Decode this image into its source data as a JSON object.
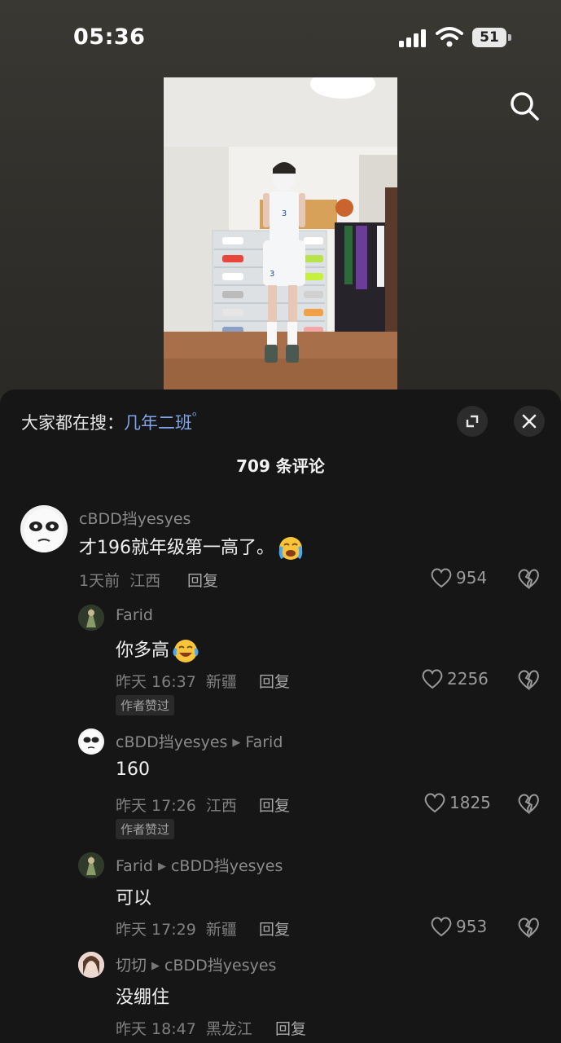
{
  "status": {
    "time": "05:36",
    "battery": "51"
  },
  "header": {
    "hot_search_prefix": "大家都在搜：",
    "hot_search_term": "几年二班"
  },
  "comment_count": "709 条评论",
  "comments": [
    {
      "user": "cBDD挡yesyes",
      "reply_to": "",
      "text": "才196就年级第一高了。",
      "time": "1天前",
      "location": "江西",
      "reply": "回复",
      "likes": "954",
      "badge": ""
    },
    {
      "user": "Farid",
      "reply_to": "",
      "text": "你多高",
      "time": "昨天 16:37",
      "location": "新疆",
      "reply": "回复",
      "likes": "2256",
      "badge": "作者赞过"
    },
    {
      "user": "cBDD挡yesyes",
      "reply_to": "Farid",
      "text": "160",
      "time": "昨天 17:26",
      "location": "江西",
      "reply": "回复",
      "likes": "1825",
      "badge": "作者赞过"
    },
    {
      "user": "Farid",
      "reply_to": "cBDD挡yesyes",
      "text": "可以",
      "time": "昨天 17:29",
      "location": "新疆",
      "reply": "回复",
      "likes": "953",
      "badge": ""
    },
    {
      "user": "切切",
      "reply_to": "cBDD挡yesyes",
      "text": "没绷住",
      "time": "昨天 18:47",
      "location": "黑龙江",
      "reply": "回复",
      "likes": "",
      "badge": ""
    }
  ],
  "icons": {
    "search": "search-icon",
    "expand": "expand-icon",
    "close": "close-icon",
    "like": "heart-icon",
    "dislike": "broken-heart-icon"
  },
  "colors": {
    "panel_bg": "#161616",
    "link": "#7fa6ea"
  }
}
